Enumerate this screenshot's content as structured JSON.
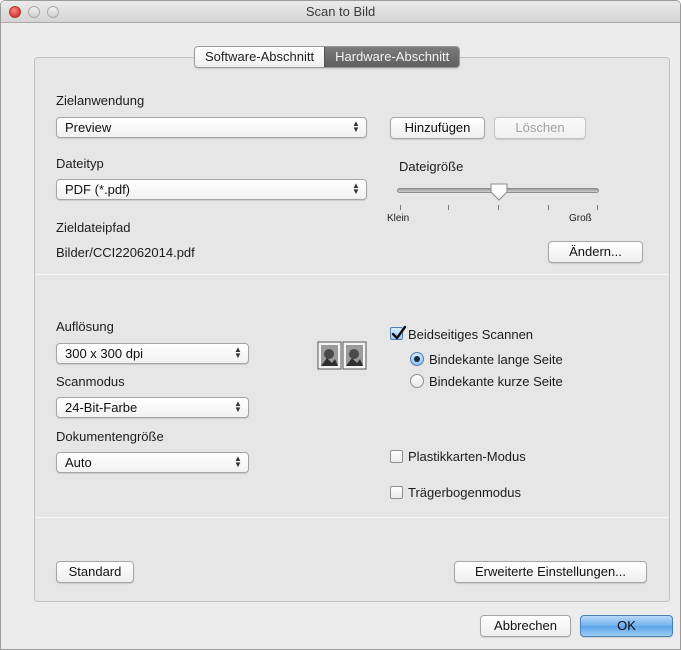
{
  "window": {
    "title": "Scan to Bild"
  },
  "tabs": [
    {
      "label": "Software-Abschnitt",
      "active": false
    },
    {
      "label": "Hardware-Abschnitt",
      "active": true
    }
  ],
  "target_app": {
    "label": "Zielanwendung",
    "value": "Preview",
    "add_button": "Hinzufügen",
    "delete_button": "Löschen"
  },
  "file_type": {
    "label": "Dateityp",
    "value": "PDF (*.pdf)"
  },
  "file_size": {
    "label": "Dateigröße",
    "min_label": "Klein",
    "max_label": "Groß",
    "level_fraction": 0.5
  },
  "destination": {
    "label": "Zieldateipfad",
    "path": "Bilder/CCI22062014.pdf",
    "change_button": "Ändern..."
  },
  "resolution": {
    "label": "Auflösung",
    "value": "300 x 300 dpi"
  },
  "scan_mode": {
    "label": "Scanmodus",
    "value": "24-Bit-Farbe"
  },
  "document_size": {
    "label": "Dokumentengröße",
    "value": "Auto"
  },
  "duplex": {
    "label": "Beidseitiges Scannen",
    "checked": true,
    "long_edge_label": "Bindekante lange Seite",
    "long_edge_selected": true,
    "short_edge_label": "Bindekante kurze Seite",
    "short_edge_selected": false
  },
  "plastic_card": {
    "label": "Plastikkarten-Modus",
    "checked": false
  },
  "carrier_sheet": {
    "label": "Trägerbogenmodus",
    "checked": false
  },
  "footer": {
    "default_button": "Standard",
    "advanced_button": "Erweiterte Einstellungen...",
    "cancel_button": "Abbrechen",
    "ok_button": "OK"
  },
  "colors": {
    "window_bg": "#ececec",
    "panel_bg": "#e6e6e6",
    "active_tab": "#6a6a6a",
    "default_button": "#6fb0ec",
    "close_button": "#e0443e"
  },
  "icons": {
    "popup_arrows": "up-down-chevron-icon",
    "duplex": "duplex-scan-icon",
    "checkmark": "checkmark-icon"
  }
}
